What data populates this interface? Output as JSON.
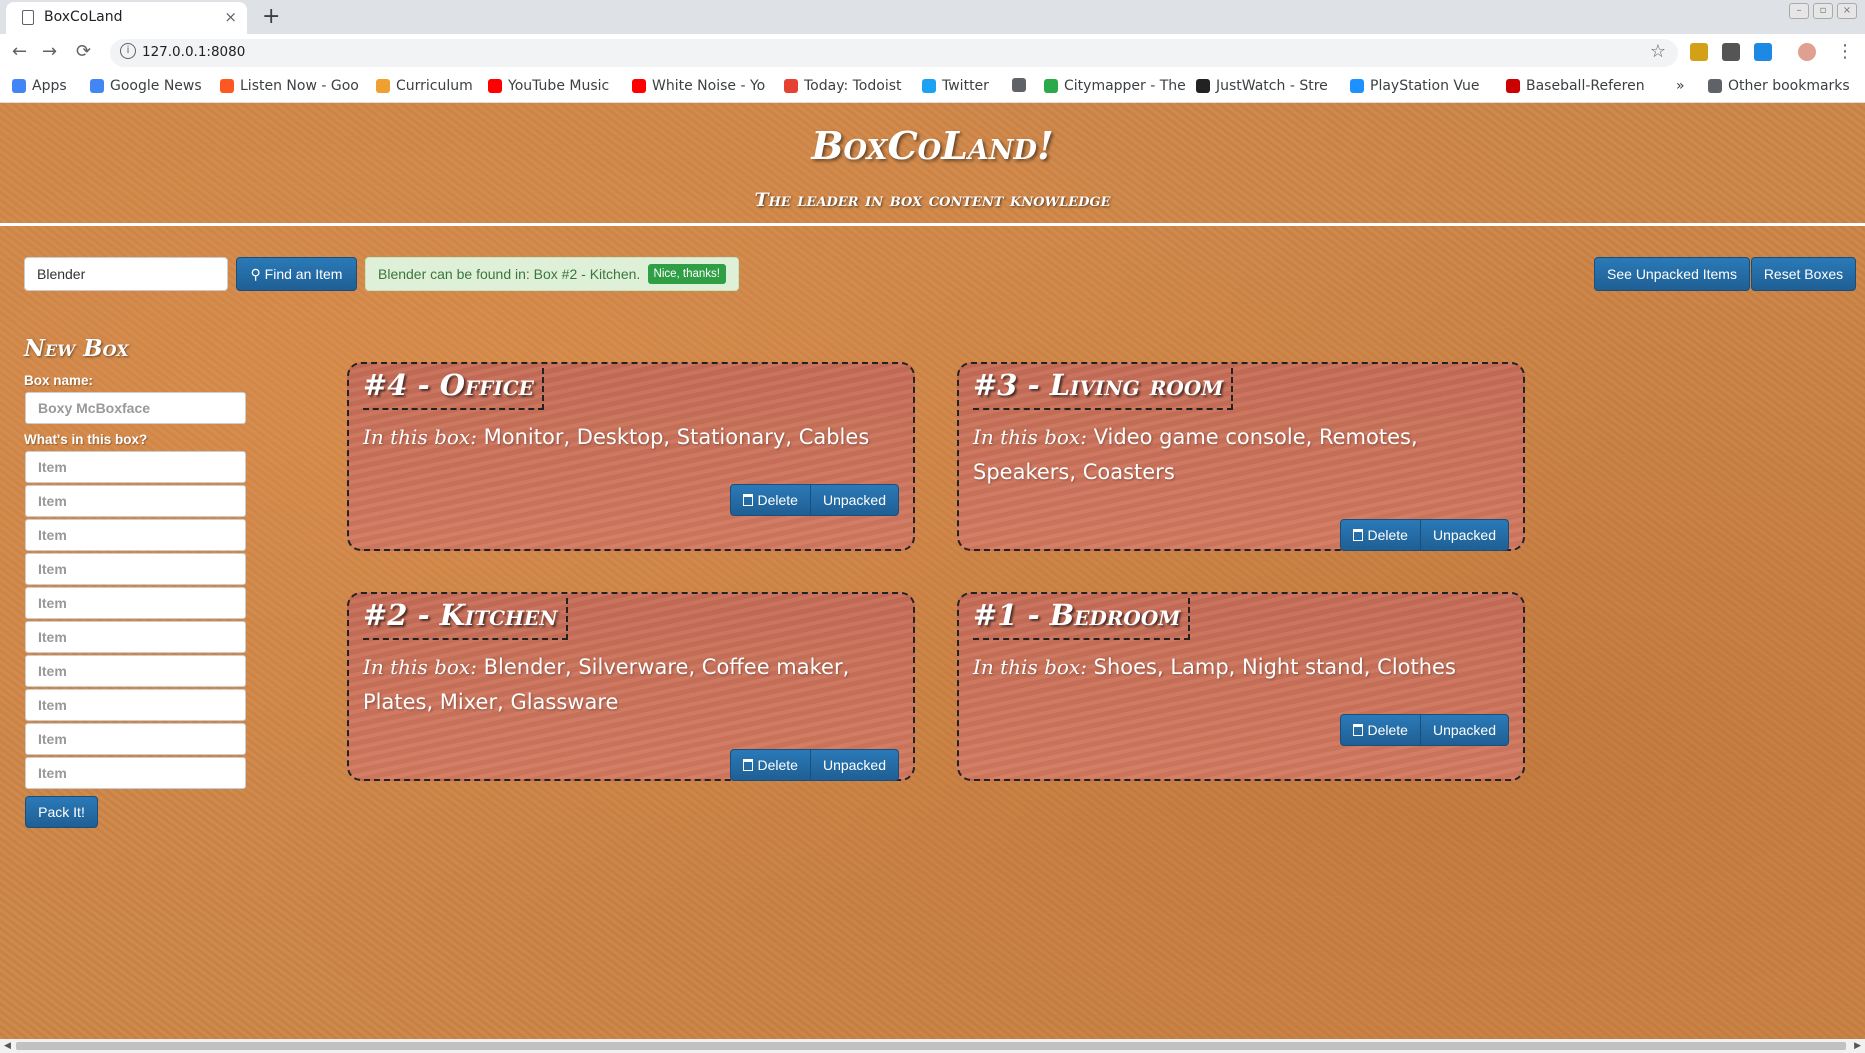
{
  "browser": {
    "tab_title": "BoxCoLand",
    "tab_close": "×",
    "new_tab": "+",
    "url": "127.0.0.1:8080",
    "back": "←",
    "forward": "→",
    "reload": "⟳",
    "star": "☆",
    "menu": "⋮",
    "win_min": "–",
    "win_max": "▫",
    "win_close": "×"
  },
  "bookmarks": [
    {
      "label": "Apps",
      "color": "#4285f4"
    },
    {
      "label": "Google News",
      "color": "#4285f4"
    },
    {
      "label": "Listen Now - Goo",
      "color": "#ff5722"
    },
    {
      "label": "Curriculum",
      "color": "#f0a030"
    },
    {
      "label": "YouTube Music",
      "color": "#ff0000"
    },
    {
      "label": "White Noise - Yo",
      "color": "#ff0000"
    },
    {
      "label": "Today: Todoist",
      "color": "#e44232"
    },
    {
      "label": "Twitter",
      "color": "#1da1f2"
    },
    {
      "label": "",
      "color": "#5f6368"
    },
    {
      "label": "Citymapper - The",
      "color": "#2ba84a"
    },
    {
      "label": "JustWatch - Stre",
      "color": "#222222"
    },
    {
      "label": "PlayStation Vue",
      "color": "#1e90ff"
    },
    {
      "label": "Baseball-Referen",
      "color": "#cc0000"
    }
  ],
  "bookmarks_overflow": "»",
  "other_bookmarks": "Other bookmarks",
  "header": {
    "title": "BoxCoLand!",
    "subtitle": "The leader in box content knowledge"
  },
  "search": {
    "value": "Blender",
    "button_label": "Find an Item",
    "result_text": "Blender can be found in: Box #2 - Kitchen.",
    "dismiss_label": "Nice, thanks!"
  },
  "actions": {
    "see_unpacked": "See Unpacked Items",
    "reset": "Reset Boxes"
  },
  "new_box": {
    "title": "New Box",
    "name_label": "Box name:",
    "name_placeholder": "Boxy McBoxface",
    "contents_label": "What's in this box?",
    "item_placeholder": "Item",
    "submit_label": "Pack It!"
  },
  "boxes": [
    {
      "title": "#4 - Office",
      "prefix": "In this box:",
      "items": "Monitor, Desktop, Stationary, Cables",
      "delete": "Delete",
      "unpacked": "Unpacked"
    },
    {
      "title": "#3 - Living room",
      "prefix": "In this box:",
      "items": "Video game console, Remotes, Speakers, Coasters",
      "delete": "Delete",
      "unpacked": "Unpacked"
    },
    {
      "title": "#2 - Kitchen",
      "prefix": "In this box:",
      "items": "Blender, Silverware, Coffee maker, Plates, Mixer, Glassware",
      "delete": "Delete",
      "unpacked": "Unpacked"
    },
    {
      "title": "#1 - Bedroom",
      "prefix": "In this box:",
      "items": "Shoes, Lamp, Night stand, Clothes",
      "delete": "Delete",
      "unpacked": "Unpacked"
    }
  ]
}
